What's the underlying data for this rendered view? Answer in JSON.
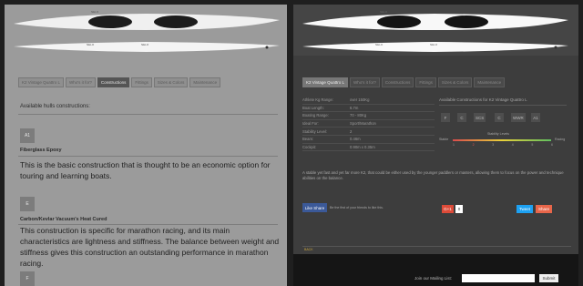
{
  "left": {
    "tabs": [
      "K2 Vintage Quattro L",
      "Who's it for?",
      "Constructions",
      "Fittings",
      "Sizes & Colors",
      "Maintenance"
    ],
    "active_tab": 2,
    "kayak_labels": [
      "NELO",
      "NELO",
      "NELO"
    ],
    "section_title": "Available hulls constructions:",
    "constructions": [
      {
        "code": "A1",
        "name": "Fiberglass Epoxy",
        "desc": "This is the basic construction that is thought to be an economic option for touring and learning boats."
      },
      {
        "code": "E",
        "name": "Carbon/Kevlar Vacuum's Heat Cured",
        "desc": "This construction is specific for marathon racing, and its main characteristics are lightness and stiffness. The balance between weight and stiffness gives this construction an outstanding performance in marathon racing."
      },
      {
        "code": "F",
        "name": "",
        "desc": ""
      }
    ]
  },
  "right": {
    "tabs": [
      "K2 Vintage Quattro L",
      "Who's it for?",
      "Constructions",
      "Fittings",
      "Sizes & Colors",
      "Maintenance"
    ],
    "active_tab": 0,
    "kayak_labels": [
      "NELO",
      "NELO",
      "NELO"
    ],
    "specs": [
      {
        "k": "Athlete Kg Range:",
        "v": "over 150Kg"
      },
      {
        "k": "Boat Length:",
        "v": "6.7m"
      },
      {
        "k": "Boating Range:",
        "v": "70 - 80Kg"
      },
      {
        "k": "Ideal For:",
        "v": "Sport/Marathon"
      },
      {
        "k": "Stability Level:",
        "v": "2"
      },
      {
        "k": "Beam:",
        "v": "0.46m"
      },
      {
        "k": "Cockpit:",
        "v": "0.90m x 0.35m"
      }
    ],
    "constructions_title": "Available Constructions for K2 Vintage Quattro L",
    "construction_chips": [
      "F",
      "C",
      "SCS",
      "C",
      "WWR",
      "A1"
    ],
    "stability_title": "Stability Levels",
    "stability_left": "Stable",
    "stability_right": "Racing",
    "stability_numbers": [
      "1",
      "2",
      "3",
      "4",
      "5",
      "6"
    ],
    "stability_value": 2,
    "description": "A stable yet fast and yet far more K2, that could be either used by the younger paddlers or masters, allowing them to focus on the power and technique abilities on the balance.",
    "like_button": "Like Share",
    "like_text": "Be the first of your friends to like this.",
    "gplus": "G+1",
    "gplus_count": "0",
    "tweet": "Tweet",
    "share": "Share",
    "back_link": "BACK",
    "newsletter_label": "Join our Mailing List:",
    "newsletter_placeholder": "",
    "submit": "Submit",
    "colors": {
      "accent": "#c8a43c",
      "stab_a": "#d94c4c",
      "stab_b": "#e8d03a",
      "stab_c": "#5fbf5f"
    }
  }
}
